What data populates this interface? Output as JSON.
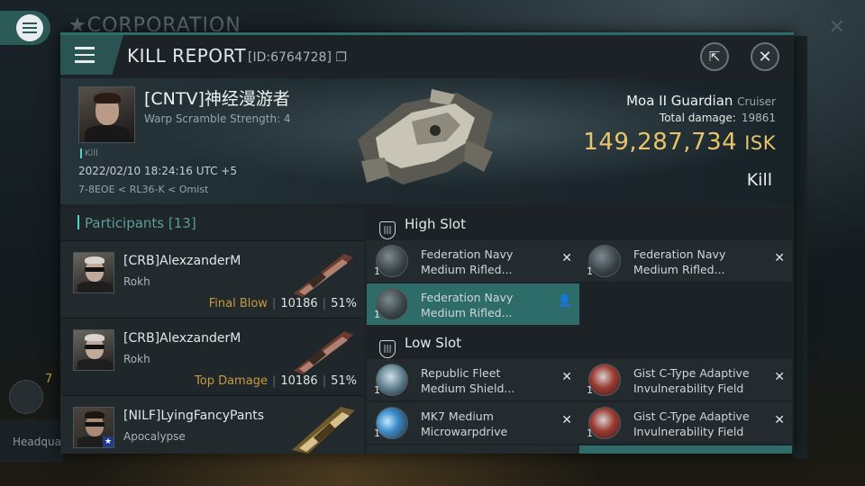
{
  "background": {
    "corp_title": "★CORPORATION",
    "close_glyph": "✕",
    "left_row_label": "Headqua",
    "left_count": "7"
  },
  "header": {
    "title": "KILL REPORT",
    "id": "[ID:6764728]",
    "copy_glyph": "❐",
    "share_glyph": "⇱",
    "close_glyph": "✕"
  },
  "victim": {
    "name": "[CNTV]神经漫游者",
    "subtitle": "Warp Scramble Strength: 4",
    "tag": "Kill",
    "time": "2022/02/10 18:24:16 UTC +5",
    "location": "7-8EOE < RL36-K < Omist",
    "ship_name": "Moa II Guardian",
    "ship_class": "Cruiser",
    "total_damage_label": "Total damage:",
    "total_damage": "19861",
    "isk_value": "149,287,734",
    "isk_unit": "ISK",
    "result": "Kill"
  },
  "participants": {
    "label": "Participants",
    "count": "[13]",
    "rows": [
      {
        "name": "[CRB]AlexzanderM",
        "ship": "Rokh",
        "tag": "Final Blow",
        "damage": "10186",
        "percent": "51%"
      },
      {
        "name": "[CRB]AlexzanderM",
        "ship": "Rokh",
        "tag": "Top Damage",
        "damage": "10186",
        "percent": "51%"
      },
      {
        "name": "[NILF]LyingFancyPants",
        "ship": "Apocalypse",
        "tag": "",
        "damage": "",
        "percent": ""
      }
    ]
  },
  "slots": {
    "high": {
      "label": "High Slot",
      "items": [
        {
          "name": "Federation Navy Medium Rifled...",
          "qty": "1",
          "action": "✕"
        },
        {
          "name": "Federation Navy Medium Rifled...",
          "qty": "1",
          "action": "✕"
        },
        {
          "name": "Federation Navy Medium Rifled...",
          "qty": "1",
          "action": "👤"
        }
      ]
    },
    "low": {
      "label": "Low Slot",
      "items": [
        {
          "name": "Republic Fleet Medium Shield...",
          "qty": "1",
          "action": "✕"
        },
        {
          "name": "Gist C-Type Adaptive Invulnerability Field",
          "qty": "1",
          "action": "✕"
        },
        {
          "name": "MK7 Medium Microwarpdrive",
          "qty": "1",
          "action": "✕"
        },
        {
          "name": "Gist C-Type Adaptive Invulnerability Field",
          "qty": "1",
          "action": "✕"
        }
      ]
    }
  }
}
